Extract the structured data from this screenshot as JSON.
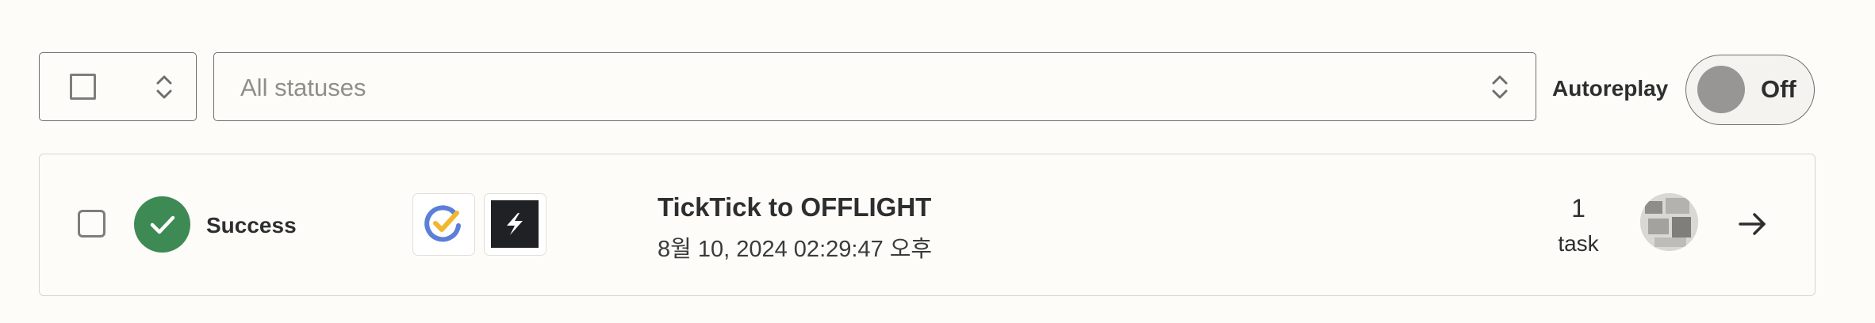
{
  "toolbar": {
    "select_all_icon": "checkbox-icon",
    "status_filter": {
      "placeholder": "All statuses"
    },
    "autoreplay": {
      "label": "Autoreplay",
      "state": "Off"
    }
  },
  "runs": [
    {
      "status": "Success",
      "status_color": "#3e8a55",
      "apps": [
        "ticktick-icon",
        "offlight-icon"
      ],
      "title": "TickTick to OFFLIGHT",
      "timestamp": "8월 10, 2024 02:29:47 오후",
      "task_count": "1",
      "task_label": "task",
      "owner_avatar": "avatar",
      "open_icon": "arrow-right-icon"
    }
  ]
}
